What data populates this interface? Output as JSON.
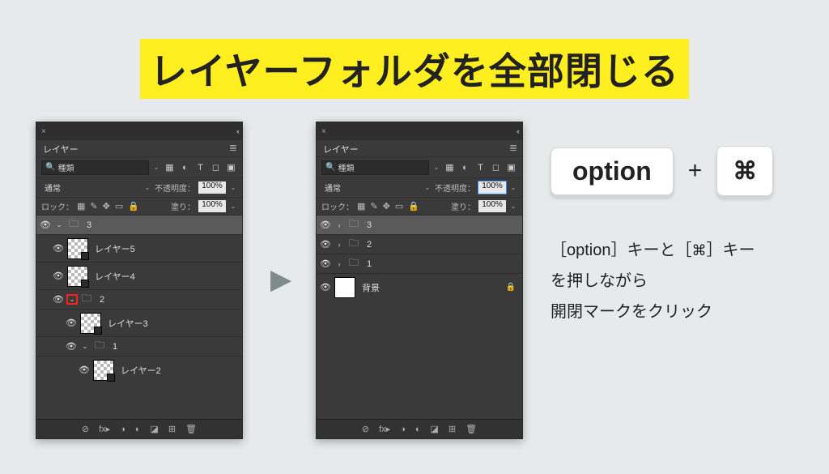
{
  "title": "レイヤーフォルダを全部閉じる",
  "keycaps": {
    "option": "option",
    "plus": "+",
    "cmd": "⌘"
  },
  "instruction": {
    "line1_a": "［option］キーと［",
    "line1_b": "］キー",
    "line2": "を押しながら",
    "line3": "開閉マークをクリック"
  },
  "panel": {
    "tab": "レイヤー",
    "search": "種類",
    "blend_mode": "通常",
    "opacity_label": "不透明度：",
    "opacity_value": "100%",
    "lock_label": "ロック：",
    "fill_label": "塗り：",
    "fill_value": "100%",
    "footer_icons": [
      "⊘",
      "fx▸",
      "◑",
      "◐",
      "◪",
      "⊞",
      "🗑"
    ]
  },
  "left_layers": [
    {
      "type": "group",
      "open": true,
      "name": "3",
      "selected": true,
      "indent": 0
    },
    {
      "type": "layer",
      "name": "レイヤー5",
      "indent": 1
    },
    {
      "type": "layer",
      "name": "レイヤー4",
      "indent": 1
    },
    {
      "type": "group",
      "open": true,
      "name": "2",
      "indent": 1,
      "highlight": true
    },
    {
      "type": "layer",
      "name": "レイヤー3",
      "indent": 2
    },
    {
      "type": "group",
      "open": true,
      "name": "1",
      "indent": 2
    },
    {
      "type": "layer",
      "name": "レイヤー2",
      "indent": 3
    }
  ],
  "right_layers": [
    {
      "type": "group",
      "open": false,
      "name": "3",
      "selected": true,
      "indent": 0
    },
    {
      "type": "group",
      "open": false,
      "name": "2",
      "indent": 0
    },
    {
      "type": "group",
      "open": false,
      "name": "1",
      "indent": 0
    },
    {
      "type": "bg",
      "name": "背景",
      "indent": 0
    }
  ]
}
